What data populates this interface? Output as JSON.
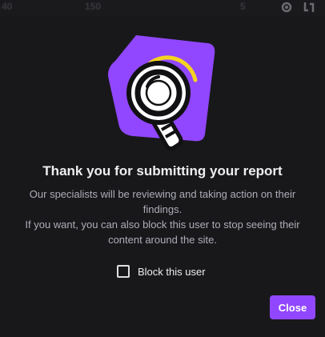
{
  "background": {
    "stats": [
      "40",
      "150",
      "5"
    ]
  },
  "modal": {
    "illustration_icon": "magnifying-glass-icon",
    "title": "Thank you for submitting your report",
    "body": {
      "line1": "Our specialists will be reviewing and taking action on their findings.",
      "line2": "If you want, you can also block this user to stop seeing their content around the site."
    },
    "block_checkbox": {
      "label": "Block this user",
      "checked": false
    },
    "close_label": "Close"
  },
  "colors": {
    "accent": "#9147ff",
    "modal_bg": "#18181b",
    "title_text": "#efeff1",
    "body_text": "#adadb8",
    "highlight_yellow": "#f5d320"
  }
}
